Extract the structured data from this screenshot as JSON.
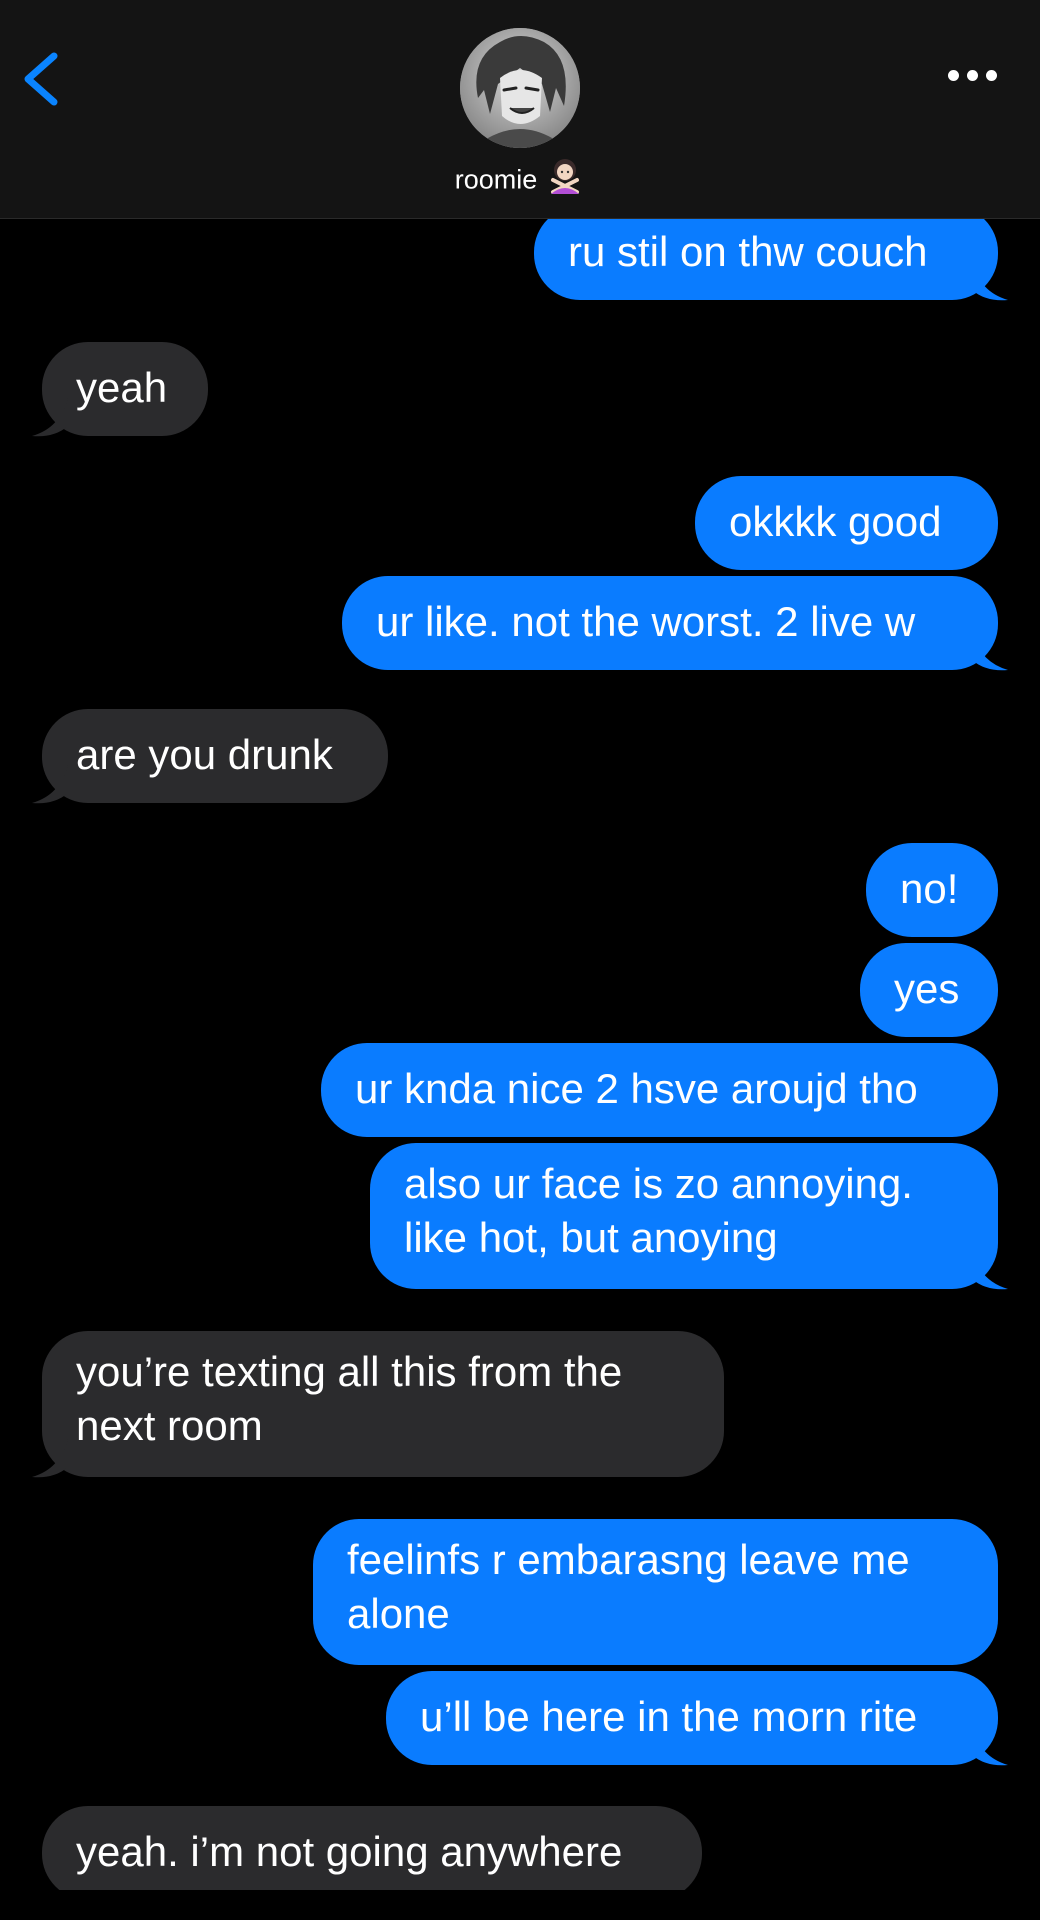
{
  "header": {
    "contact_name": "roomie",
    "contact_emoji": "person-gesturing-no-emoji",
    "back_icon": "chevron-left-icon",
    "more_icon": "ellipsis-icon",
    "avatar": "anime-character-avatar"
  },
  "colors": {
    "outgoing_bubble": "#0a7cff",
    "incoming_bubble": "#2b2b2d",
    "background": "#000000",
    "header_background": "#141414",
    "accent": "#0a84ff"
  },
  "messages": [
    {
      "direction": "outgoing",
      "text": "ru stil on thw couch"
    },
    {
      "direction": "incoming",
      "text": "yeah"
    },
    {
      "direction": "outgoing",
      "text": "okkkk good"
    },
    {
      "direction": "outgoing",
      "text": "ur like. not the worst. 2 live w"
    },
    {
      "direction": "incoming",
      "text": "are you drunk"
    },
    {
      "direction": "outgoing",
      "text": "no!"
    },
    {
      "direction": "outgoing",
      "text": "yes"
    },
    {
      "direction": "outgoing",
      "text": "ur knda nice 2 hsve aroujd tho"
    },
    {
      "direction": "outgoing",
      "text": "also ur face is zo annoying. like hot, but anoying"
    },
    {
      "direction": "incoming",
      "text": "you’re texting all this from the next room"
    },
    {
      "direction": "outgoing",
      "text": "feelinfs r embarasng leave me alone"
    },
    {
      "direction": "outgoing",
      "text": "u’ll be here in the morn rite"
    },
    {
      "direction": "incoming",
      "text": "yeah. i’m not going anywhere"
    }
  ]
}
